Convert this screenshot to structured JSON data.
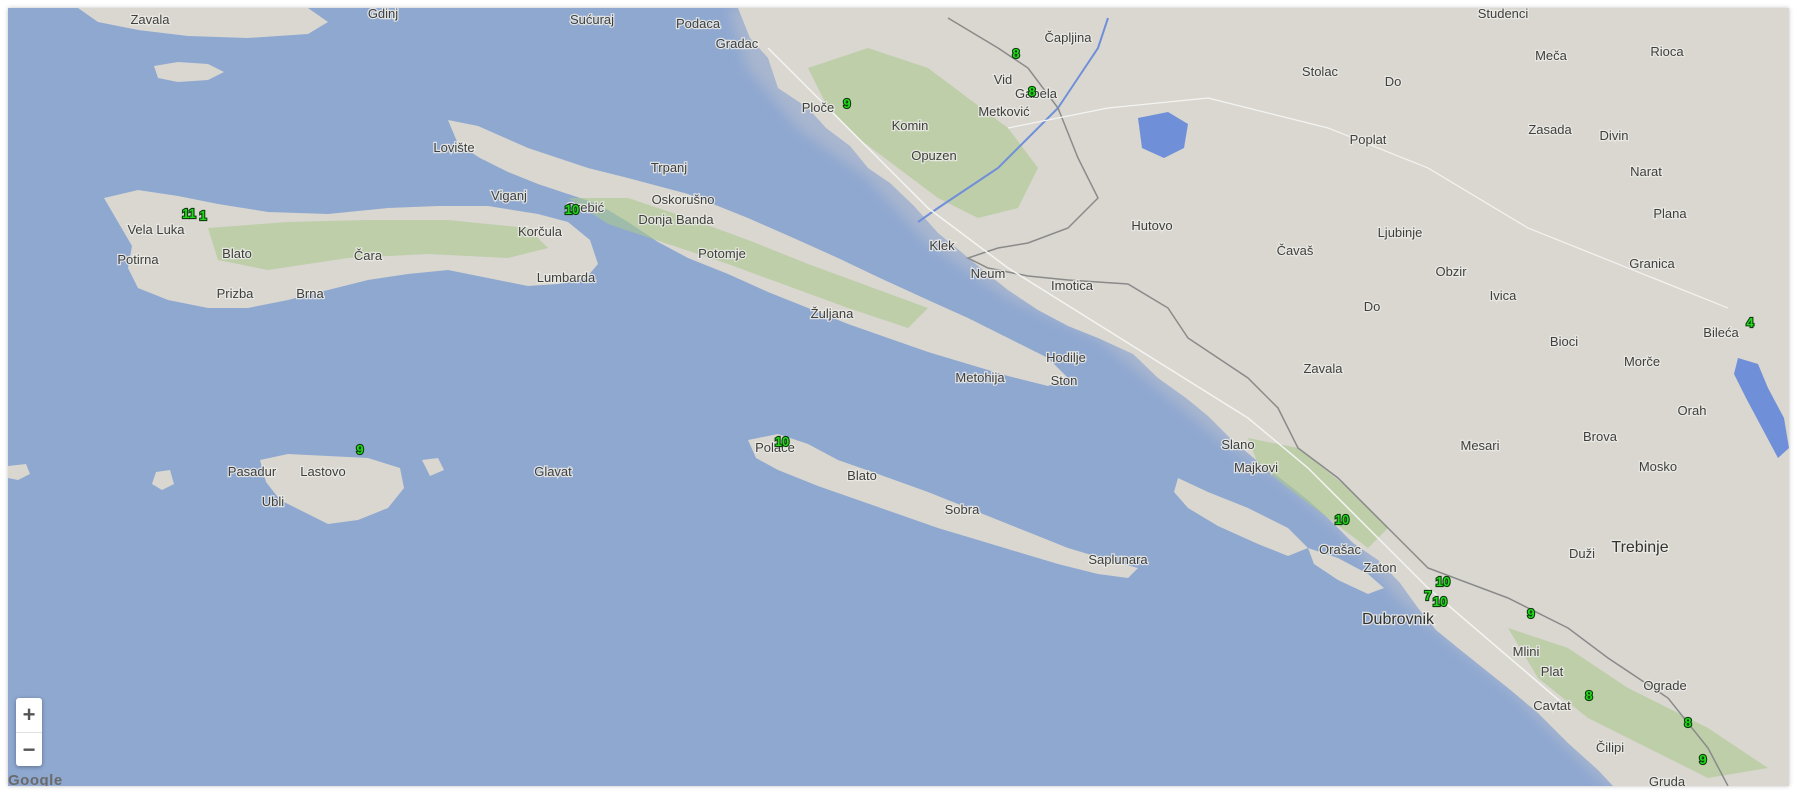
{
  "map": {
    "colors": {
      "sea": "#8fa8d0",
      "land": "#d9d7d0",
      "greenery": "#aac890",
      "water": "#6f8fd8",
      "border": "#8a8a8a",
      "road": "#f4f4f2",
      "marker_fill": "#22d81a"
    },
    "places": [
      {
        "id": "zavala-n",
        "name": "Zavala"
      },
      {
        "id": "gdinj",
        "name": "Gdinj"
      },
      {
        "id": "sucuraj",
        "name": "Sućuraj"
      },
      {
        "id": "podaca",
        "name": "Podaca"
      },
      {
        "id": "gradac",
        "name": "Gradac"
      },
      {
        "id": "capljina",
        "name": "Čapljina"
      },
      {
        "id": "studenci",
        "name": "Studenci"
      },
      {
        "id": "meca",
        "name": "Meča"
      },
      {
        "id": "rioca",
        "name": "Rioca"
      },
      {
        "id": "stolac",
        "name": "Stolac"
      },
      {
        "id": "do-n",
        "name": "Do"
      },
      {
        "id": "vid",
        "name": "Vid"
      },
      {
        "id": "gabela",
        "name": "Gabela"
      },
      {
        "id": "metkovic",
        "name": "Metković"
      },
      {
        "id": "ploce",
        "name": "Ploče"
      },
      {
        "id": "komin",
        "name": "Komin"
      },
      {
        "id": "opuzen",
        "name": "Opuzen"
      },
      {
        "id": "poplat",
        "name": "Poplat"
      },
      {
        "id": "zasada",
        "name": "Zasada"
      },
      {
        "id": "divin",
        "name": "Divin"
      },
      {
        "id": "narat",
        "name": "Narat"
      },
      {
        "id": "plana",
        "name": "Plana"
      },
      {
        "id": "loviste",
        "name": "Lovište"
      },
      {
        "id": "trpanj",
        "name": "Trpanj"
      },
      {
        "id": "viganj",
        "name": "Viganj"
      },
      {
        "id": "orebic",
        "name": "Orebić"
      },
      {
        "id": "oskorusno",
        "name": "Oskorušno"
      },
      {
        "id": "donja-banda",
        "name": "Donja Banda"
      },
      {
        "id": "korcula",
        "name": "Korčula"
      },
      {
        "id": "vela-luka",
        "name": "Vela Luka"
      },
      {
        "id": "blato-k",
        "name": "Blato"
      },
      {
        "id": "cara",
        "name": "Čara"
      },
      {
        "id": "potirna",
        "name": "Potirna"
      },
      {
        "id": "prizba",
        "name": "Prizba"
      },
      {
        "id": "brna",
        "name": "Brna"
      },
      {
        "id": "lumbarda",
        "name": "Lumbarda"
      },
      {
        "id": "potomje",
        "name": "Potomje"
      },
      {
        "id": "klek",
        "name": "Klek"
      },
      {
        "id": "neum",
        "name": "Neum"
      },
      {
        "id": "hutovo",
        "name": "Hutovo"
      },
      {
        "id": "imotica",
        "name": "Imotica"
      },
      {
        "id": "cavas",
        "name": "Čavaš"
      },
      {
        "id": "ljubinje",
        "name": "Ljubinje"
      },
      {
        "id": "obzir",
        "name": "Obzir"
      },
      {
        "id": "granica",
        "name": "Granica"
      },
      {
        "id": "zuljana",
        "name": "Žuljana"
      },
      {
        "id": "do-s",
        "name": "Do"
      },
      {
        "id": "ivica",
        "name": "Ivica"
      },
      {
        "id": "bileca",
        "name": "Bileća"
      },
      {
        "id": "bioci",
        "name": "Bioci"
      },
      {
        "id": "morce",
        "name": "Morče"
      },
      {
        "id": "hodilje",
        "name": "Hodilje"
      },
      {
        "id": "metohija",
        "name": "Metohija"
      },
      {
        "id": "ston",
        "name": "Ston"
      },
      {
        "id": "zavala-s",
        "name": "Zavala"
      },
      {
        "id": "orah",
        "name": "Orah"
      },
      {
        "id": "brova",
        "name": "Brova"
      },
      {
        "id": "mesari",
        "name": "Mesari"
      },
      {
        "id": "mosko",
        "name": "Mosko"
      },
      {
        "id": "slano",
        "name": "Slano"
      },
      {
        "id": "majkovi",
        "name": "Majkovi"
      },
      {
        "id": "pasadur",
        "name": "Pasadur"
      },
      {
        "id": "lastovo",
        "name": "Lastovo"
      },
      {
        "id": "ubli",
        "name": "Ubli"
      },
      {
        "id": "glavat",
        "name": "Glavat"
      },
      {
        "id": "polace",
        "name": "Polače"
      },
      {
        "id": "blato-m",
        "name": "Blato"
      },
      {
        "id": "sobra",
        "name": "Sobra"
      },
      {
        "id": "saplunara",
        "name": "Saplunara"
      },
      {
        "id": "orasac",
        "name": "Orašac"
      },
      {
        "id": "zaton",
        "name": "Zaton"
      },
      {
        "id": "trebinje",
        "name": "Trebinje"
      },
      {
        "id": "duzi",
        "name": "Duži"
      },
      {
        "id": "dubrovnik",
        "name": "Dubrovnik"
      },
      {
        "id": "mlini",
        "name": "Mlini"
      },
      {
        "id": "plat",
        "name": "Plat"
      },
      {
        "id": "ograde",
        "name": "Ograde"
      },
      {
        "id": "cavtat",
        "name": "Cavtat"
      },
      {
        "id": "cilipi",
        "name": "Čilipi"
      },
      {
        "id": "gruda",
        "name": "Gruda"
      }
    ],
    "markers": [
      {
        "id": "m-vid",
        "value": "8"
      },
      {
        "id": "m-metkovic",
        "value": "8"
      },
      {
        "id": "m-ploce",
        "value": "9"
      },
      {
        "id": "m-vela-luka-1",
        "value": "11"
      },
      {
        "id": "m-vela-luka-2",
        "value": "1"
      },
      {
        "id": "m-korcula",
        "value": "10"
      },
      {
        "id": "m-bileca",
        "value": "4"
      },
      {
        "id": "m-lastovo",
        "value": "9"
      },
      {
        "id": "m-polace",
        "value": "10"
      },
      {
        "id": "m-orasac",
        "value": "10"
      },
      {
        "id": "m-dubrovnik-1",
        "value": "10"
      },
      {
        "id": "m-dubrovnik-2",
        "value": "7"
      },
      {
        "id": "m-dubrovnik-3",
        "value": "10"
      },
      {
        "id": "m-mlini",
        "value": "9"
      },
      {
        "id": "m-cavtat",
        "value": "8"
      },
      {
        "id": "m-cilipi",
        "value": "8"
      },
      {
        "id": "m-gruda",
        "value": "9"
      }
    ]
  },
  "controls": {
    "zoom_in_label": "+",
    "zoom_out_label": "−"
  },
  "attribution": {
    "text": "Google"
  }
}
